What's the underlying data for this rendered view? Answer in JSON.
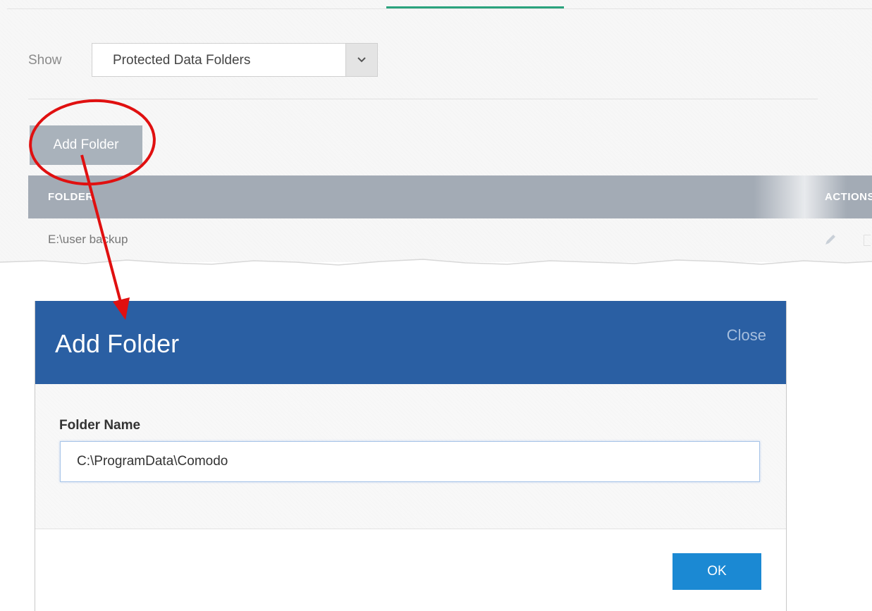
{
  "filter": {
    "label": "Show",
    "selected": "Protected Data Folders"
  },
  "toolbar": {
    "add_folder_label": "Add Folder"
  },
  "table": {
    "columns": [
      "FOLDER",
      "ACTIONS"
    ],
    "rows": [
      {
        "folder": "E:\\user backup"
      }
    ]
  },
  "dialog": {
    "title": "Add Folder",
    "close_label": "Close",
    "field_label": "Folder Name",
    "field_value": "C:\\ProgramData\\Comodo",
    "ok_label": "OK"
  },
  "icons": {
    "select_arrow": "chevron-down-icon",
    "edit": "pencil-icon",
    "delete": "trash-icon"
  },
  "colors": {
    "dialog_header": "#2a5fa3",
    "ok_button": "#1b89d3",
    "table_header": "#a3abb5",
    "annotation": "#e01010",
    "tab_accent": "#2aa37d"
  }
}
